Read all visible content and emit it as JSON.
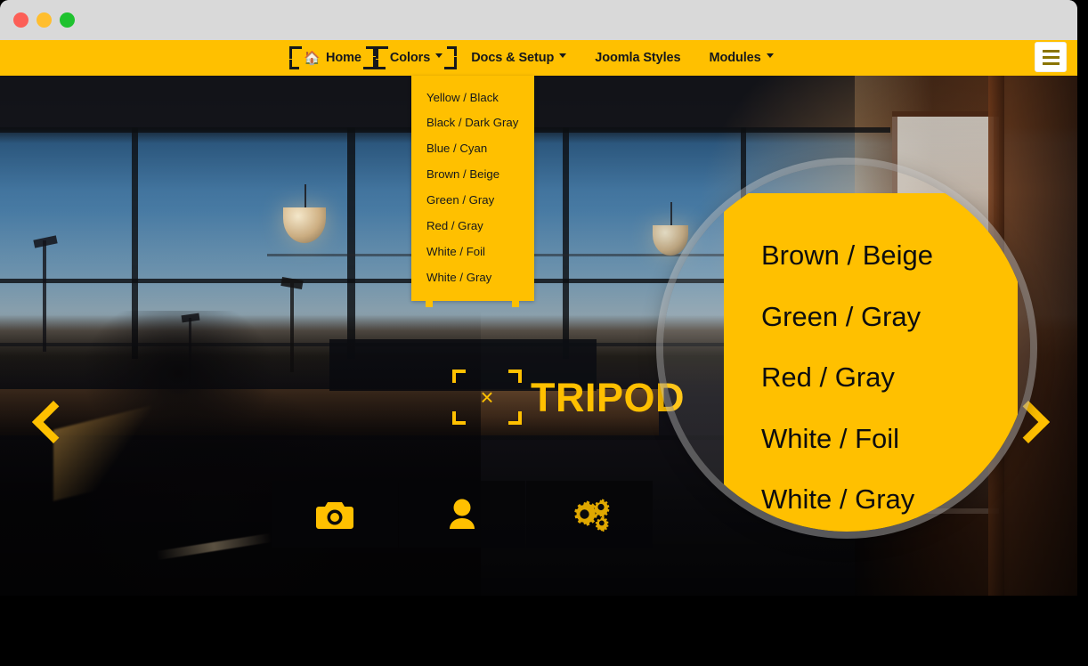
{
  "window": {
    "controls": [
      {
        "name": "close",
        "color": "#fc5f57"
      },
      {
        "name": "minimize",
        "color": "#ffbe2e"
      },
      {
        "name": "maximize",
        "color": "#1fc22f"
      }
    ]
  },
  "theme": {
    "accent_yellow": "#ffc000",
    "ink_black": "#16181c",
    "chrome_gray": "#d9d9d9",
    "lens_ring": "#cdcdcd"
  },
  "navbar": {
    "items": [
      {
        "label": "Home",
        "icon": "home-icon",
        "has_caret": false,
        "bracketed": true,
        "active": true
      },
      {
        "label": "Colors",
        "icon": null,
        "has_caret": true,
        "bracketed": true,
        "active": true
      },
      {
        "label": "Docs & Setup",
        "icon": null,
        "has_caret": true,
        "bracketed": false,
        "active": false
      },
      {
        "label": "Joomla Styles",
        "icon": null,
        "has_caret": false,
        "bracketed": false,
        "active": false
      },
      {
        "label": "Modules",
        "icon": null,
        "has_caret": true,
        "bracketed": false,
        "active": false
      }
    ],
    "toggle_icon": "hamburger-icon"
  },
  "colors_dropdown": {
    "open": true,
    "items": [
      "Yellow / Black",
      "Black / Dark Gray",
      "Blue / Cyan",
      "Brown / Beige",
      "Green / Gray",
      "Red / Gray",
      "White / Foil",
      "White / Gray"
    ]
  },
  "magnifier": {
    "visible_items": [
      "Brown / Beige",
      "Green / Gray",
      "Red / Gray",
      "White / Foil",
      "White / Gray"
    ]
  },
  "hero": {
    "title": "TRIPOD",
    "focus_marker": "×",
    "scene": "airport terminal windows at dusk with silhouetted traveler",
    "feature_cards": [
      {
        "icon": "camera-icon"
      },
      {
        "icon": "user-icon"
      },
      {
        "icon": "gears-icon"
      }
    ],
    "slider": {
      "prev_icon": "chevron-left-icon",
      "next_icon": "chevron-right-icon"
    }
  }
}
